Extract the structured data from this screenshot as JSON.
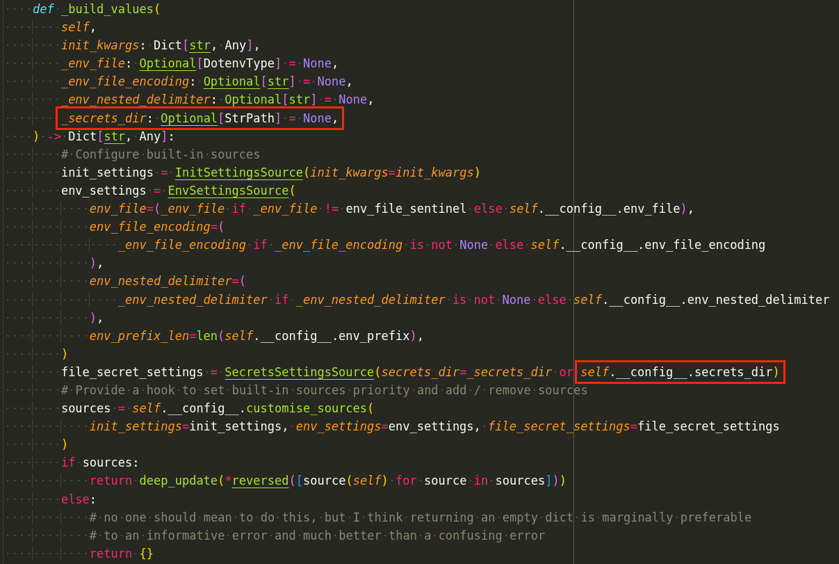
{
  "editor": {
    "lines": [
      {
        "tokens": [
          {
            "kind": "storage",
            "text": "    def"
          },
          {
            "kind": "func",
            "text": " _build_values"
          },
          {
            "kind": "b1",
            "text": "("
          }
        ]
      },
      {
        "tokens": [
          {
            "kind": "param",
            "text": "        self"
          },
          {
            "kind": "plain",
            "text": ","
          }
        ]
      },
      {
        "tokens": [
          {
            "kind": "param",
            "text": "        init_kwargs"
          },
          {
            "kind": "plain",
            "text": ": Dict"
          },
          {
            "kind": "b2",
            "text": "["
          },
          {
            "kind": "type",
            "text": "str"
          },
          {
            "kind": "plain",
            "text": ", Any"
          },
          {
            "kind": "b2",
            "text": "]"
          },
          {
            "kind": "plain",
            "text": ","
          }
        ]
      },
      {
        "tokens": [
          {
            "kind": "param",
            "text": "        _env_file"
          },
          {
            "kind": "plain",
            "text": ": "
          },
          {
            "kind": "type",
            "text": "Optional"
          },
          {
            "kind": "b2",
            "text": "["
          },
          {
            "kind": "plain",
            "text": "DotenvType"
          },
          {
            "kind": "b2",
            "text": "]"
          },
          {
            "kind": "op",
            "text": " = "
          },
          {
            "kind": "const",
            "text": "None"
          },
          {
            "kind": "plain",
            "text": ","
          }
        ]
      },
      {
        "tokens": [
          {
            "kind": "param",
            "text": "        _env_file_encoding"
          },
          {
            "kind": "plain",
            "text": ": "
          },
          {
            "kind": "type",
            "text": "Optional"
          },
          {
            "kind": "b2",
            "text": "["
          },
          {
            "kind": "type",
            "text": "str"
          },
          {
            "kind": "b2",
            "text": "]"
          },
          {
            "kind": "op",
            "text": " = "
          },
          {
            "kind": "const",
            "text": "None"
          },
          {
            "kind": "plain",
            "text": ","
          }
        ]
      },
      {
        "tokens": [
          {
            "kind": "param",
            "text": "        _env_nested_delimiter"
          },
          {
            "kind": "plain",
            "text": ": "
          },
          {
            "kind": "type",
            "text": "Optional"
          },
          {
            "kind": "b2",
            "text": "["
          },
          {
            "kind": "type",
            "text": "str"
          },
          {
            "kind": "b2",
            "text": "]"
          },
          {
            "kind": "op",
            "text": " = "
          },
          {
            "kind": "const",
            "text": "None"
          },
          {
            "kind": "plain",
            "text": ","
          }
        ]
      },
      {
        "boxed": [
          {
            "kind": "param",
            "text": "        _secrets_dir"
          },
          {
            "kind": "plain",
            "text": ": "
          },
          {
            "kind": "type",
            "text": "Optional"
          },
          {
            "kind": "b2",
            "text": "["
          },
          {
            "kind": "plain",
            "text": "StrPath"
          },
          {
            "kind": "b2",
            "text": "]"
          },
          {
            "kind": "op",
            "text": " = "
          },
          {
            "kind": "const",
            "text": "None"
          },
          {
            "kind": "plain",
            "text": ","
          }
        ]
      },
      {
        "tokens": [
          {
            "kind": "b1",
            "text": "    )"
          },
          {
            "kind": "op",
            "text": " ->"
          },
          {
            "kind": "plain",
            "text": " Dict"
          },
          {
            "kind": "b2",
            "text": "["
          },
          {
            "kind": "type",
            "text": "str"
          },
          {
            "kind": "plain",
            "text": ", Any"
          },
          {
            "kind": "b2",
            "text": "]"
          },
          {
            "kind": "plain",
            "text": ":"
          }
        ]
      },
      {
        "tokens": [
          {
            "kind": "comment",
            "text": "        # Configure built-in sources"
          }
        ]
      },
      {
        "tokens": [
          {
            "kind": "plain",
            "text": "        init_settings"
          },
          {
            "kind": "op",
            "text": " = "
          },
          {
            "kind": "type",
            "text": "InitSettingsSource"
          },
          {
            "kind": "b1",
            "text": "("
          },
          {
            "kind": "param",
            "text": "init_kwargs"
          },
          {
            "kind": "op",
            "text": "="
          },
          {
            "kind": "param",
            "text": "init_kwargs"
          },
          {
            "kind": "b1",
            "text": ")"
          }
        ]
      },
      {
        "tokens": [
          {
            "kind": "plain",
            "text": "        env_settings"
          },
          {
            "kind": "op",
            "text": " = "
          },
          {
            "kind": "type",
            "text": "EnvSettingsSource"
          },
          {
            "kind": "b1",
            "text": "("
          }
        ]
      },
      {
        "tokens": [
          {
            "kind": "param",
            "text": "            env_file"
          },
          {
            "kind": "op",
            "text": "="
          },
          {
            "kind": "b2",
            "text": "("
          },
          {
            "kind": "param",
            "text": "_env_file"
          },
          {
            "kind": "kw",
            "text": " if "
          },
          {
            "kind": "param",
            "text": "_env_file"
          },
          {
            "kind": "op",
            "text": " != "
          },
          {
            "kind": "plain",
            "text": "env_file_sentinel"
          },
          {
            "kind": "kw",
            "text": " else "
          },
          {
            "kind": "param",
            "text": "self"
          },
          {
            "kind": "plain",
            "text": ".__config__.env_file"
          },
          {
            "kind": "b2",
            "text": ")"
          },
          {
            "kind": "plain",
            "text": ","
          }
        ]
      },
      {
        "tokens": [
          {
            "kind": "param",
            "text": "            env_file_encoding"
          },
          {
            "kind": "op",
            "text": "="
          },
          {
            "kind": "b2",
            "text": "("
          }
        ]
      },
      {
        "tokens": [
          {
            "kind": "param",
            "text": "                _env_file_encoding"
          },
          {
            "kind": "kw",
            "text": " if "
          },
          {
            "kind": "param",
            "text": "_env_file_encoding"
          },
          {
            "kind": "kw",
            "text": " is not "
          },
          {
            "kind": "const",
            "text": "None"
          },
          {
            "kind": "kw",
            "text": " else "
          },
          {
            "kind": "param",
            "text": "self"
          },
          {
            "kind": "plain",
            "text": ".__config__.env_file_encoding"
          }
        ]
      },
      {
        "tokens": [
          {
            "kind": "b2",
            "text": "            )"
          },
          {
            "kind": "plain",
            "text": ","
          }
        ]
      },
      {
        "tokens": [
          {
            "kind": "param",
            "text": "            env_nested_delimiter"
          },
          {
            "kind": "op",
            "text": "="
          },
          {
            "kind": "b2",
            "text": "("
          }
        ]
      },
      {
        "tokens": [
          {
            "kind": "param",
            "text": "                _env_nested_delimiter"
          },
          {
            "kind": "kw",
            "text": " if "
          },
          {
            "kind": "param",
            "text": "_env_nested_delimiter"
          },
          {
            "kind": "kw",
            "text": " is not "
          },
          {
            "kind": "const",
            "text": "None"
          },
          {
            "kind": "kw",
            "text": " else "
          },
          {
            "kind": "param",
            "text": "self"
          },
          {
            "kind": "plain",
            "text": ".__config__.env_nested_delimiter"
          }
        ]
      },
      {
        "tokens": [
          {
            "kind": "b2",
            "text": "            )"
          },
          {
            "kind": "plain",
            "text": ","
          }
        ]
      },
      {
        "tokens": [
          {
            "kind": "param",
            "text": "            env_prefix_len"
          },
          {
            "kind": "op",
            "text": "="
          },
          {
            "kind": "func",
            "text": "len"
          },
          {
            "kind": "b2",
            "text": "("
          },
          {
            "kind": "param",
            "text": "self"
          },
          {
            "kind": "plain",
            "text": ".__config__.env_prefix"
          },
          {
            "kind": "b2",
            "text": ")"
          },
          {
            "kind": "plain",
            "text": ","
          }
        ]
      },
      {
        "tokens": [
          {
            "kind": "b1",
            "text": "        )"
          }
        ]
      },
      {
        "tokens": [
          {
            "kind": "plain",
            "text": "        file_secret_settings"
          },
          {
            "kind": "op",
            "text": " = "
          },
          {
            "kind": "type",
            "text": "SecretsSettingsSource"
          },
          {
            "kind": "b1",
            "text": "("
          },
          {
            "kind": "param",
            "text": "secrets_dir"
          },
          {
            "kind": "op",
            "text": "="
          },
          {
            "kind": "param",
            "text": "_secrets_dir"
          },
          {
            "kind": "kw",
            "text": " or "
          }
        ],
        "boxed": [
          {
            "kind": "param",
            "text": "self"
          },
          {
            "kind": "plain",
            "text": ".__config__.secrets_dir"
          },
          {
            "kind": "b1",
            "text": ")"
          }
        ]
      },
      {
        "tokens": [
          {
            "kind": "comment",
            "text": "        # Provide a hook to set built-in sources priority and add / remove sources"
          }
        ]
      },
      {
        "tokens": [
          {
            "kind": "plain",
            "text": "        sources"
          },
          {
            "kind": "op",
            "text": " = "
          },
          {
            "kind": "param",
            "text": "self"
          },
          {
            "kind": "plain",
            "text": ".__config__."
          },
          {
            "kind": "func",
            "text": "customise_sources"
          },
          {
            "kind": "b1",
            "text": "("
          }
        ]
      },
      {
        "tokens": [
          {
            "kind": "param",
            "text": "            init_settings"
          },
          {
            "kind": "op",
            "text": "="
          },
          {
            "kind": "plain",
            "text": "init_settings, "
          },
          {
            "kind": "param",
            "text": "env_settings"
          },
          {
            "kind": "op",
            "text": "="
          },
          {
            "kind": "plain",
            "text": "env_settings, "
          },
          {
            "kind": "param",
            "text": "file_secret_settings"
          },
          {
            "kind": "op",
            "text": "="
          },
          {
            "kind": "plain",
            "text": "file_secret_settings"
          }
        ]
      },
      {
        "tokens": [
          {
            "kind": "b1",
            "text": "        )"
          }
        ]
      },
      {
        "tokens": [
          {
            "kind": "kw",
            "text": "        if"
          },
          {
            "kind": "plain",
            "text": " sources:"
          }
        ]
      },
      {
        "tokens": [
          {
            "kind": "kw",
            "text": "            return"
          },
          {
            "kind": "func",
            "text": " deep_update"
          },
          {
            "kind": "b1",
            "text": "("
          },
          {
            "kind": "op",
            "text": "*"
          },
          {
            "kind": "type",
            "text": "reversed"
          },
          {
            "kind": "b2",
            "text": "("
          },
          {
            "kind": "b3",
            "text": "["
          },
          {
            "kind": "plain",
            "text": "source"
          },
          {
            "kind": "b1",
            "text": "("
          },
          {
            "kind": "param",
            "text": "self"
          },
          {
            "kind": "b1",
            "text": ")"
          },
          {
            "kind": "kw",
            "text": " for "
          },
          {
            "kind": "plain",
            "text": "source"
          },
          {
            "kind": "kw",
            "text": " in "
          },
          {
            "kind": "plain",
            "text": "sources"
          },
          {
            "kind": "b3",
            "text": "]"
          },
          {
            "kind": "b2",
            "text": ")"
          },
          {
            "kind": "b1",
            "text": ")"
          }
        ]
      },
      {
        "tokens": [
          {
            "kind": "kw",
            "text": "        else"
          },
          {
            "kind": "plain",
            "text": ":"
          }
        ]
      },
      {
        "tokens": [
          {
            "kind": "comment",
            "text": "            # no one should mean to do this, but I think returning an empty dict is marginally preferable"
          }
        ]
      },
      {
        "tokens": [
          {
            "kind": "comment",
            "text": "            # to an informative error and much better than a confusing error"
          }
        ]
      },
      {
        "tokens": [
          {
            "kind": "kw",
            "text": "            return"
          },
          {
            "kind": "b1",
            "text": " {}"
          }
        ]
      }
    ]
  }
}
